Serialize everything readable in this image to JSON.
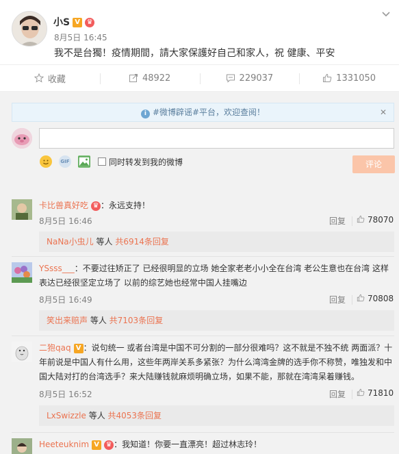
{
  "post": {
    "author": "小S",
    "time": "8月5日 16:45",
    "text": "我不是台獨！疫情期間，請大家保護好自己和家人，祝  健康、平安"
  },
  "actions": {
    "favorite": "收藏",
    "repost_count": "48922",
    "comment_count": "229037",
    "like_count": "1331050"
  },
  "notice": {
    "text": "#微博辟谣#平台，欢迎查阅！"
  },
  "composer": {
    "placeholder": "",
    "repost_label": "同时转发到我的微博",
    "submit_label": "评论"
  },
  "comments": [
    {
      "user": "卡比兽真好吃",
      "text": "：永远支持！",
      "time": "8月5日 16:46",
      "reply_label": "回复",
      "likes": "78070",
      "sub_user": "NaNa小虫儿",
      "sub_mid": " 等人 ",
      "sub_count": "共6914条回复"
    },
    {
      "user": "YSsss___",
      "text": "：不要过往矫正了 已经很明显的立场 她全家老老小小全在台湾 老公生意也在台湾 这样表达已经很坚定立场了 以前的综艺她也经常中国人挂嘴边",
      "time": "8月5日 16:49",
      "reply_label": "回复",
      "likes": "70808",
      "sub_user": "笑出来赔声",
      "sub_mid": " 等人 ",
      "sub_count": "共7103条回复"
    },
    {
      "user": "二狍qaq",
      "text": "：说句统一 或者台湾是中国不可分割的一部分很难吗？这不就是不独不统 两面派？十年前说是中国人有什么用，这些年两岸关系多紧张？为什么湾湾金牌的选手你不称赞，唯独发和中国大陆对打的台湾选手？来大陆赚钱就麻烦明确立场，如果不能，那就在湾湾呆着赚钱。",
      "time": "8月5日 16:52",
      "reply_label": "回复",
      "likes": "71810",
      "sub_user": "LxSwizzle",
      "sub_mid": " 等人 ",
      "sub_count": "共4053条回复"
    },
    {
      "user": "Heeteuknim",
      "text": "：我知道！你要一直漂亮！超过林志玲！"
    }
  ],
  "colors": {
    "accent": "#eb7350",
    "link": "#5a7e9d",
    "muted": "#808080",
    "submit_disabled": "#fbc5a9"
  },
  "icons": {
    "favorite": "star-icon",
    "repost": "repost-icon",
    "comment": "comment-icon",
    "like": "thumbs-up-icon",
    "more": "chevron-down-icon",
    "notice": "info-icon",
    "close": "close-icon"
  }
}
